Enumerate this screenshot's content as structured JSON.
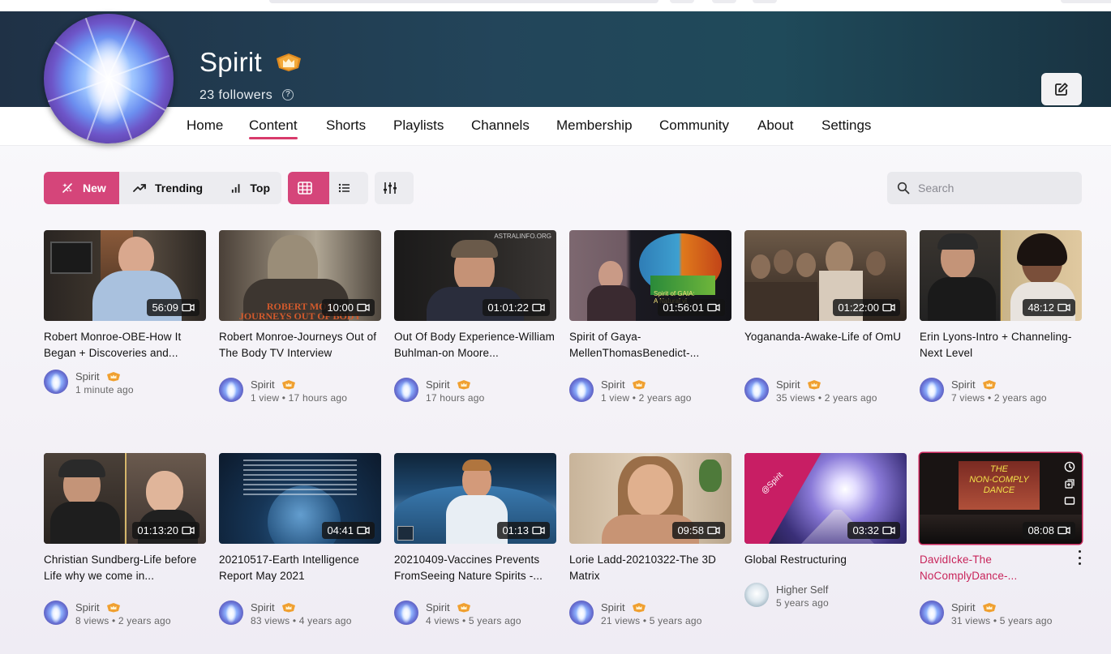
{
  "channel": {
    "name": "Spirit",
    "followers": "23 followers",
    "accent_color": "#d5457a"
  },
  "tabs": [
    {
      "label": "Home"
    },
    {
      "label": "Content",
      "active": true
    },
    {
      "label": "Shorts"
    },
    {
      "label": "Playlists"
    },
    {
      "label": "Channels"
    },
    {
      "label": "Membership"
    },
    {
      "label": "Community"
    },
    {
      "label": "About"
    },
    {
      "label": "Settings"
    }
  ],
  "sort": {
    "new": "New",
    "trending": "Trending",
    "top": "Top",
    "selected": "New"
  },
  "view": {
    "selected": "grid"
  },
  "search": {
    "placeholder": "Search"
  },
  "videos": [
    {
      "title": "Robert Monroe-OBE-How It Began + Discoveries and...",
      "duration": "56:09",
      "author": "Spirit",
      "stats": "1 minute ago"
    },
    {
      "title": "Robert Monroe-Journeys Out of The Body TV Interview",
      "duration": "10:00",
      "author": "Spirit",
      "stats": "1 view • 17 hours ago",
      "thumb_text": "ROBERT MON\nJOURNEYS OUT OF BODY"
    },
    {
      "title": "Out Of Body Experience-William Buhlman-on Moore...",
      "duration": "01:01:22",
      "author": "Spirit",
      "stats": "17 hours ago",
      "thumb_text": "ASTRALINFO.ORG"
    },
    {
      "title": "Spirit of Gaya-MellenThomasBenedict-...",
      "duration": "01:56:01",
      "author": "Spirit",
      "stats": "1 view • 2 years ago",
      "thumb_text": "Spirit of GAIA:\nA Natural vi"
    },
    {
      "title": "Yogananda-Awake-Life of OmU",
      "duration": "01:22:00",
      "author": "Spirit",
      "stats": "35 views • 2 years ago"
    },
    {
      "title": "Erin Lyons-Intro + Channeling-Next Level",
      "duration": "48:12",
      "author": "Spirit",
      "stats": "7 views • 2 years ago"
    },
    {
      "title": "Christian Sundberg-Life before Life why we come in...",
      "duration": "01:13:20",
      "author": "Spirit",
      "stats": "8 views • 2 years ago"
    },
    {
      "title": "20210517-Earth Intelligence Report May 2021",
      "duration": "04:41",
      "author": "Spirit",
      "stats": "83 views • 4 years ago"
    },
    {
      "title": "20210409-Vaccines Prevents FromSeeing Nature Spirits -...",
      "duration": "01:13",
      "author": "Spirit",
      "stats": "4 views • 5 years ago"
    },
    {
      "title": "Lorie Ladd-20210322-The 3D Matrix",
      "duration": "09:58",
      "author": "Spirit",
      "stats": "21 views • 5 years ago"
    },
    {
      "title": "Global Restructuring",
      "duration": "03:32",
      "author": "Higher Self",
      "stats": "5 years ago",
      "thumb_text": "@Spirit"
    },
    {
      "title": "DavidIcke-The NoComplyDance-...",
      "duration": "08:08",
      "author": "Spirit",
      "stats": "31 views • 5 years ago",
      "thumb_text": "THE\nNON-COMPLY\nDANCE"
    }
  ]
}
